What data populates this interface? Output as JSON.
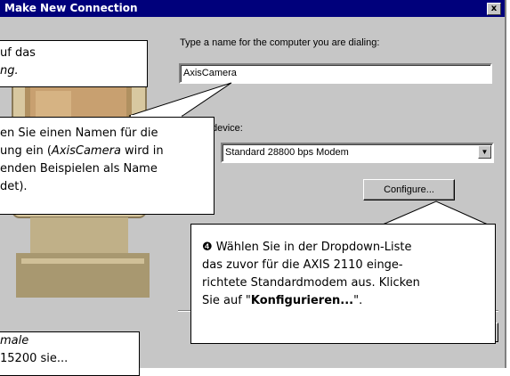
{
  "dialog": {
    "title": "Make New Connection",
    "close_glyph": "x",
    "name_prompt": "Type a name for the computer you are dialing:",
    "name_value": "AxisCamera",
    "device_label": "device:",
    "modem_value": "Standard 28800 bps Modem",
    "configure_label": "Configure..."
  },
  "notes": {
    "n1_l1": "uf das",
    "n1_l2": "ng.",
    "n2_l1": "en Sie einen Namen für die",
    "n2_l2a": "ung ein (",
    "n2_l2b": "AxisCamera",
    "n2_l2c": " wird in",
    "n2_l3": "enden Beispielen als Name",
    "n2_l4": "det).",
    "n3_l1a": "❹ Wählen Sie in der Dropdown-Liste",
    "n3_l2": "das zuvor für die AXIS 2110 einge-",
    "n3_l3": "richtete Standardmodem aus. Klicken",
    "n3_l4a": "Sie auf \"",
    "n3_l4b": "Konfigurieren...",
    "n3_l4c": "\".",
    "n4_l1": "male",
    "n4_l2": "15200 sie..."
  },
  "colors": {
    "titlebar": "#00007b",
    "dialog": "#c6c6c6"
  }
}
